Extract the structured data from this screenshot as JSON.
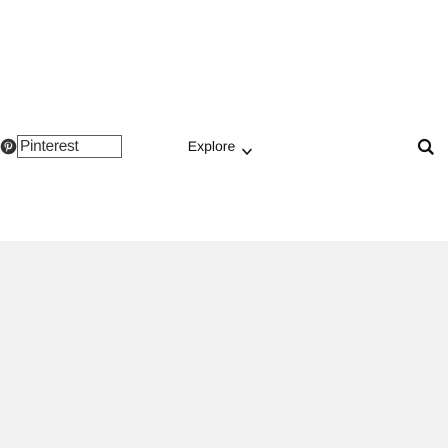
{
  "header": {
    "logo_icon": "pinterest-logo-icon",
    "brand_label": "Pinterest",
    "explore_label": "Explore",
    "explore_icon": "chevron-down-icon",
    "search_icon": "search-icon"
  },
  "colors": {
    "background": "#ffffff",
    "content_area": "#f1f1f1",
    "text": "#111111",
    "logo": "#333333"
  }
}
